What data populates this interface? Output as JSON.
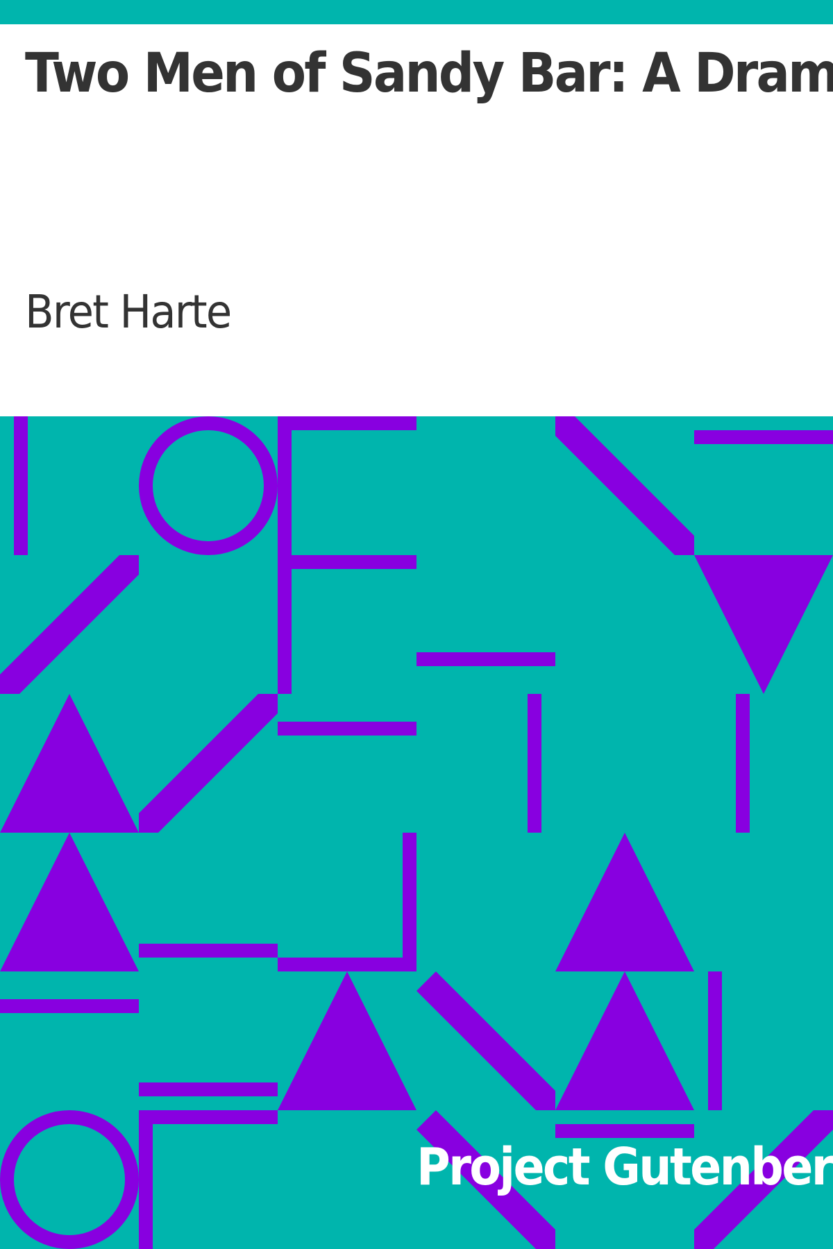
{
  "book": {
    "title": "Two Men of Sandy Bar: A Drama",
    "author": "Bret Harte",
    "publisher": "Project Gutenberg"
  },
  "colors": {
    "background": "#00b5ad",
    "pattern": "#8800e0",
    "title_panel": "#ffffff",
    "title_text": "#333333",
    "publisher_text": "#ffffff"
  }
}
